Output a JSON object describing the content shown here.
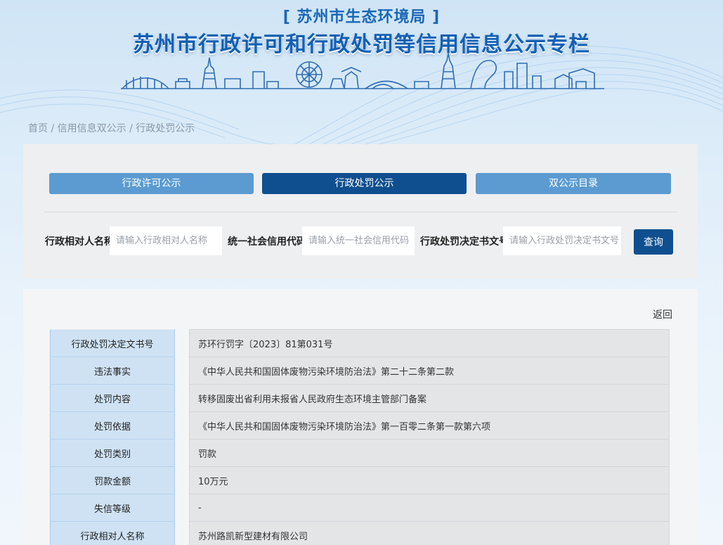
{
  "header": {
    "subtitle": "[ 苏州市生态环境局 ]",
    "title": "苏州市行政许可和行政处罚等信用信息公示专栏"
  },
  "breadcrumb": {
    "items": [
      "首页",
      "信用信息双公示",
      "行政处罚公示"
    ],
    "separator": " / "
  },
  "tabs": [
    {
      "label": "行政许可公示",
      "active": false
    },
    {
      "label": "行政处罚公示",
      "active": true
    },
    {
      "label": "双公示目录",
      "active": false
    }
  ],
  "search": {
    "fields": [
      {
        "label": "行政相对人名称",
        "placeholder": "请输入行政相对人名称",
        "value": ""
      },
      {
        "label": "统一社会信用代码",
        "placeholder": "请输入统一社会信用代码",
        "value": ""
      },
      {
        "label": "行政处罚决定书文号",
        "placeholder": "请输入行政处罚决定书文号",
        "value": ""
      }
    ],
    "button_label": "查询"
  },
  "detail": {
    "back_label": "返回",
    "rows": [
      {
        "key": "行政处罚决定文书号",
        "value": "苏环行罚字〔2023〕81第031号"
      },
      {
        "key": "违法事实",
        "value": "《中华人民共和国固体废物污染环境防治法》第二十二条第二款"
      },
      {
        "key": "处罚内容",
        "value": "转移固废出省利用未报省人民政府生态环境主管部门备案"
      },
      {
        "key": "处罚依据",
        "value": "《中华人民共和国固体废物污染环境防治法》第一百零二条第一款第六项"
      },
      {
        "key": "处罚类别",
        "value": "罚款"
      },
      {
        "key": "罚款金额",
        "value": "10万元"
      },
      {
        "key": "失信等级",
        "value": "-"
      },
      {
        "key": "行政相对人名称",
        "value": "苏州路凯新型建材有限公司"
      }
    ]
  },
  "colors": {
    "primary_dark": "#0f4f8f",
    "primary_light": "#5b9bd1",
    "title_blue": "#1160b4"
  }
}
